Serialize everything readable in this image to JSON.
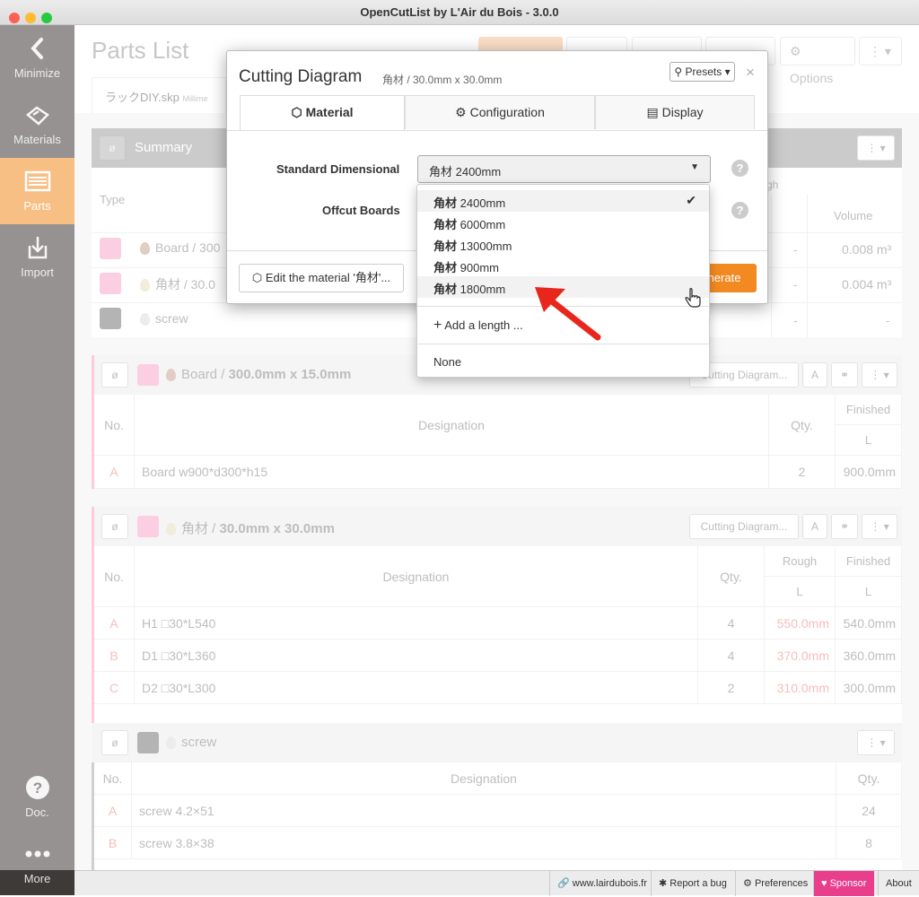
{
  "window": {
    "title": "OpenCutList by L'Air du Bois - 3.0.0"
  },
  "sidebar": {
    "items": [
      {
        "label": "Minimize"
      },
      {
        "label": "Materials"
      },
      {
        "label": "Parts"
      },
      {
        "label": "Import"
      },
      {
        "label": "Doc."
      },
      {
        "label": "More"
      }
    ]
  },
  "header": {
    "title": "Parts List",
    "options_label": "Options",
    "file_tab": "ラックDIY.skp",
    "file_unit": "Millime"
  },
  "summary": {
    "title": "Summary",
    "col_type": "Type",
    "col_volume": "Volume",
    "col_gh": "gh",
    "rows": [
      {
        "name": "Board / 300",
        "volume": "0.008 m³",
        "dash": "-"
      },
      {
        "name": "角材 / 30.0",
        "volume": "0.004 m³",
        "dash": "-"
      },
      {
        "name": "screw",
        "volume": "-",
        "dash": "-"
      }
    ]
  },
  "group_board": {
    "title_plain": "Board / ",
    "title_bold": "300.0mm x 15.0mm",
    "cutting_label": "Cutting Diagram...",
    "col_no": "No.",
    "col_designation": "Designation",
    "col_qty": "Qty.",
    "col_finished": "Finished",
    "col_l": "L",
    "rows": [
      {
        "no": "A",
        "designation": "Board w900*d300*h15",
        "qty": "2",
        "finished": "900.0mm"
      }
    ]
  },
  "group_kakuzai": {
    "title_plain": "角材 / ",
    "title_bold": "30.0mm x 30.0mm",
    "cutting_label": "Cutting Diagram...",
    "col_no": "No.",
    "col_designation": "Designation",
    "col_qty": "Qty.",
    "col_rough": "Rough",
    "col_finished": "Finished",
    "col_l": "L",
    "rows": [
      {
        "no": "A",
        "designation": "H1 □30*L540",
        "qty": "4",
        "rough": "550.0mm",
        "finished": "540.0mm"
      },
      {
        "no": "B",
        "designation": "D1 □30*L360",
        "qty": "4",
        "rough": "370.0mm",
        "finished": "360.0mm"
      },
      {
        "no": "C",
        "designation": "D2 □30*L300",
        "qty": "2",
        "rough": "310.0mm",
        "finished": "300.0mm"
      }
    ]
  },
  "group_screw": {
    "title": "screw",
    "col_no": "No.",
    "col_designation": "Designation",
    "col_qty": "Qty.",
    "rows": [
      {
        "no": "A",
        "designation": "screw 4.2×51",
        "qty": "24"
      },
      {
        "no": "B",
        "designation": "screw 3.8×38",
        "qty": "8"
      }
    ]
  },
  "dialog": {
    "title": "Cutting Diagram",
    "subtitle": "角材 / 30.0mm x 30.0mm",
    "presets_label": "Presets",
    "close": "×",
    "tabs": [
      "Material",
      "Configuration",
      "Display"
    ],
    "std_label": "Standard Dimensional",
    "std_value": "角材 2400mm",
    "offcut_label": "Offcut Boards",
    "edit_material_label": "Edit the material '角材'...",
    "generate_label": "nerate"
  },
  "dropdown": {
    "options": [
      {
        "bold": "角材",
        "rest": " 2400mm",
        "selected": true
      },
      {
        "bold": "角材",
        "rest": " 6000mm"
      },
      {
        "bold": "角材",
        "rest": " 13000mm"
      },
      {
        "bold": "角材",
        "rest": " 900mm"
      },
      {
        "bold": "角材",
        "rest": " 1800mm",
        "hovered": true
      }
    ],
    "add_length": "Add a length ...",
    "none": "None"
  },
  "statusbar": {
    "site": "www.lairdubois.fr",
    "report": "Report a bug",
    "preferences": "Preferences",
    "sponsor": "Sponsor",
    "about": "About"
  },
  "colors": {
    "accent": "#f28a21",
    "sidebar": "#3e3a37",
    "pink": "#f7a8c9",
    "sponsor": "#e83e8c",
    "red_arrow": "#e8261c"
  }
}
